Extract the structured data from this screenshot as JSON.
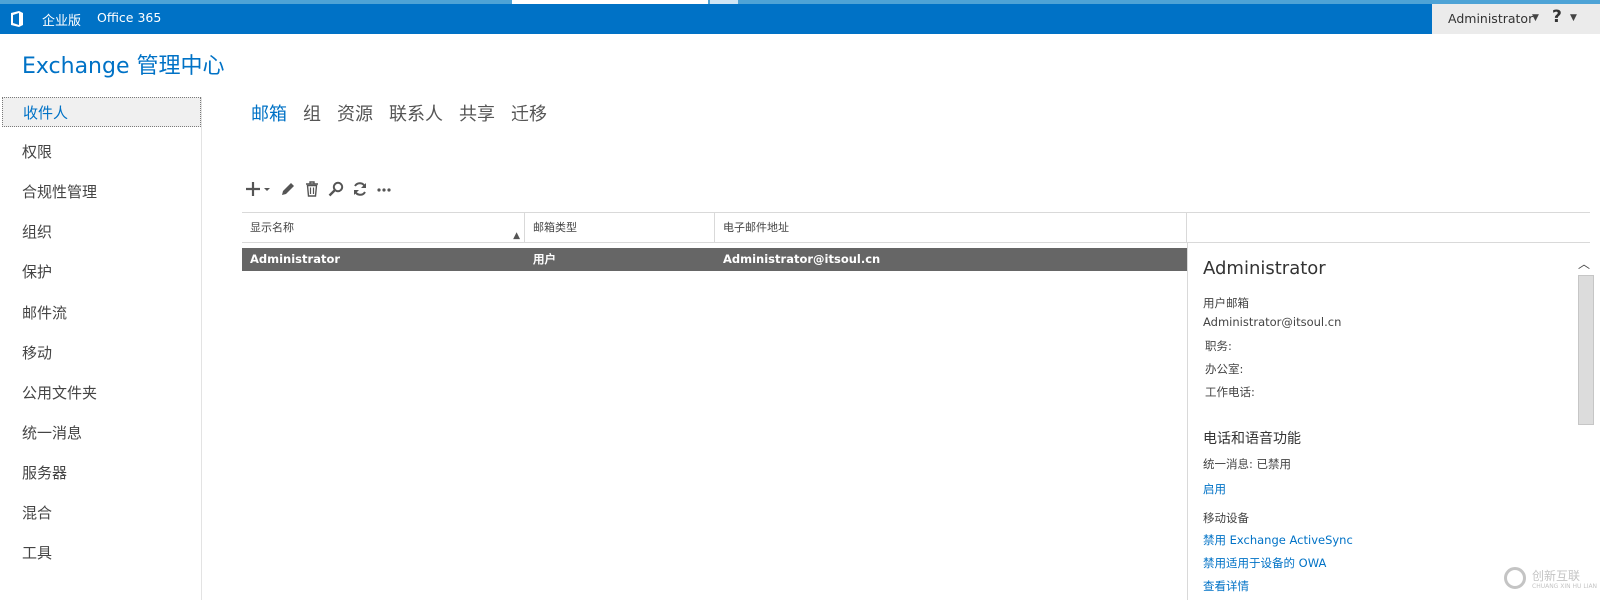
{
  "header": {
    "edition": "企业版",
    "office": "Office 365",
    "user": "Administrator",
    "help": "?"
  },
  "app_title": "Exchange 管理中心",
  "nav": {
    "items": [
      "收件人",
      "权限",
      "合规性管理",
      "组织",
      "保护",
      "邮件流",
      "移动",
      "公用文件夹",
      "统一消息",
      "服务器",
      "混合",
      "工具"
    ],
    "active": "收件人"
  },
  "tabs": [
    "邮箱",
    "组",
    "资源",
    "联系人",
    "共享",
    "迁移"
  ],
  "toolbar": {
    "icons": [
      "add-icon",
      "edit-icon",
      "delete-icon",
      "search-icon",
      "refresh-icon",
      "more-icon"
    ]
  },
  "table": {
    "columns": [
      "显示名称",
      "邮箱类型",
      "电子邮件地址"
    ],
    "rows": [
      {
        "name": "Administrator",
        "type": "用户",
        "email": "Administrator@itsoul.cn"
      }
    ]
  },
  "details": {
    "name": "Administrator",
    "mailbox_label": "用户邮箱",
    "email": "Administrator@itsoul.cn",
    "title_label": "职务:",
    "office_label": "办公室:",
    "phone_label": "工作电话:",
    "phone_voice_header": "电话和语音功能",
    "um_status": "统一消息:  已禁用",
    "enable_link": "启用",
    "mobile_header": "移动设备",
    "disable_activesync": "禁用 Exchange ActiveSync",
    "disable_owa": "禁用适用于设备的 OWA",
    "view_details": "查看详情"
  },
  "watermark": {
    "text": "创新互联",
    "sub": "CHUANG XIN HU LIAN"
  },
  "colors": {
    "brand": "#0072c6",
    "selected_row": "#666666"
  }
}
